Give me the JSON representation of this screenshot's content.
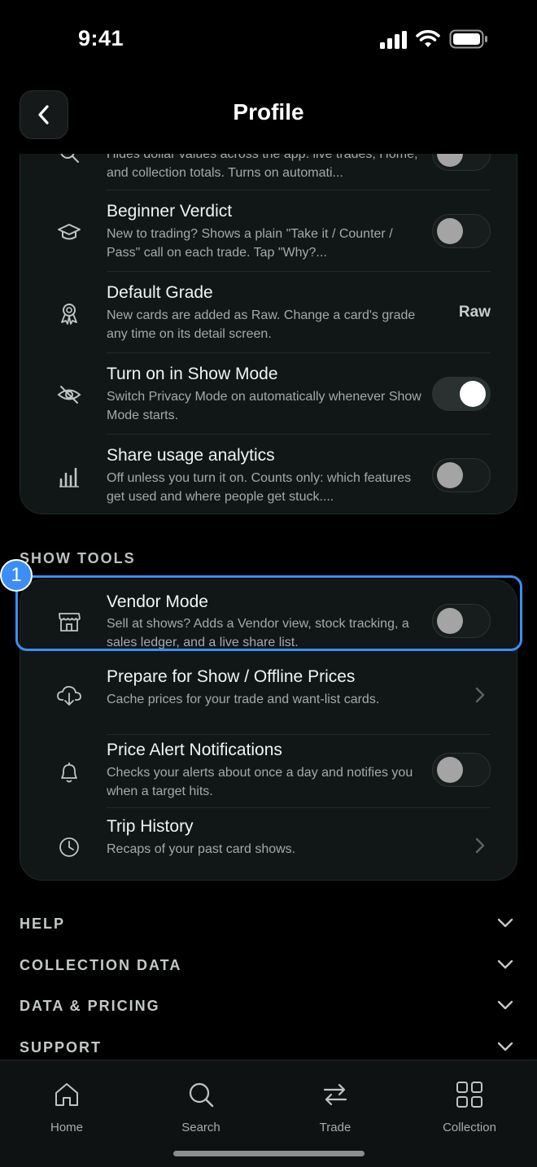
{
  "status_bar": {
    "time": "9:41"
  },
  "header": {
    "title": "Profile"
  },
  "privacy_card": {
    "rows": [
      {
        "title": "",
        "desc": "Hides dollar values across the app: live trades, Home, and collection totals. Turns on automati...",
        "control": "toggle",
        "on": false,
        "icon": "eye-search-icon"
      },
      {
        "title": "Beginner Verdict",
        "desc": "New to trading? Shows a plain \"Take it / Counter / Pass\" call on each trade. Tap \"Why?...",
        "control": "toggle",
        "on": false,
        "icon": "graduation-cap-icon"
      },
      {
        "title": "Default Grade",
        "desc": "New cards are added as Raw. Change a card's grade any time on its detail screen.",
        "control": "value",
        "value": "Raw",
        "icon": "award-ribbon-icon"
      },
      {
        "title": "Turn on in Show Mode",
        "desc": "Switch Privacy Mode on automatically whenever Show Mode starts.",
        "control": "toggle",
        "on": true,
        "icon": "eye-off-icon"
      },
      {
        "title": "Share usage analytics",
        "desc": "Off unless you turn it on. Counts only: which features get used and where people get stuck....",
        "control": "toggle",
        "on": false,
        "icon": "bar-chart-icon"
      }
    ]
  },
  "show_tools": {
    "label": "SHOW TOOLS",
    "rows": [
      {
        "title": "Vendor Mode",
        "desc": "Sell at shows? Adds a Vendor view, stock tracking, a sales ledger, and a live share list.",
        "control": "toggle",
        "on": false,
        "icon": "storefront-icon"
      },
      {
        "title": "Prepare for Show / Offline Prices",
        "desc": "Cache prices for your trade and want-list cards.",
        "control": "chevron",
        "icon": "cloud-download-icon"
      },
      {
        "title": "Price Alert Notifications",
        "desc": "Checks your alerts about once a day and notifies you when a target hits.",
        "control": "toggle",
        "on": false,
        "icon": "bell-icon"
      },
      {
        "title": "Trip History",
        "desc": "Recaps of your past card shows.",
        "control": "chevron",
        "icon": "clock-icon"
      }
    ]
  },
  "collapsed_sections": [
    "HELP",
    "COLLECTION DATA",
    "DATA & PRICING",
    "SUPPORT"
  ],
  "annotation": {
    "badge": "1"
  },
  "tabs": [
    {
      "label": "Home",
      "icon": "home-icon"
    },
    {
      "label": "Search",
      "icon": "search-icon"
    },
    {
      "label": "Trade",
      "icon": "swap-arrows-icon"
    },
    {
      "label": "Collection",
      "icon": "grid-icon"
    }
  ],
  "colors": {
    "accent": "#3b8ef5",
    "card_bg": "#101716",
    "page_bg": "#000000"
  }
}
